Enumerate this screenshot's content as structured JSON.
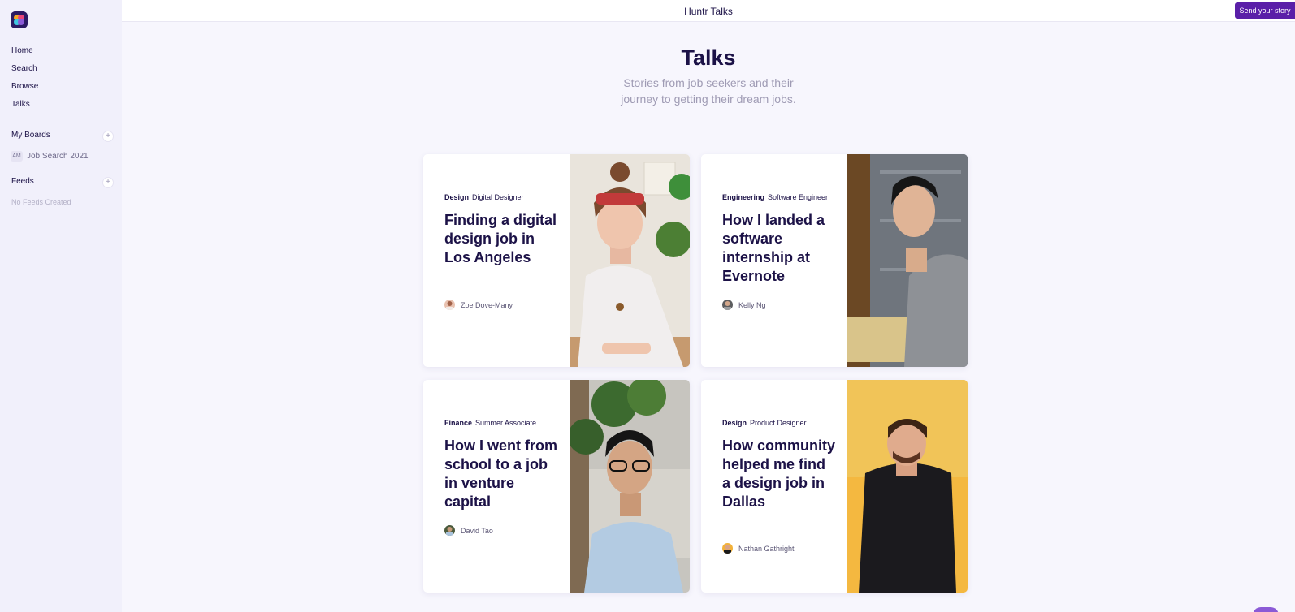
{
  "app": {
    "title": "Huntr Talks",
    "send_button": "Send your story"
  },
  "sidebar": {
    "nav": [
      "Home",
      "Search",
      "Browse",
      "Talks"
    ],
    "boards_heading": "My Boards",
    "boards": [
      {
        "initials": "AM",
        "name": "Job Search 2021"
      }
    ],
    "feeds_heading": "Feeds",
    "feeds_empty": "No Feeds Created",
    "add_symbol": "+"
  },
  "hero": {
    "title": "Talks",
    "subtitle_line1": "Stories from job seekers and their",
    "subtitle_line2": "journey to getting their dream jobs."
  },
  "cards": [
    {
      "category": "Design",
      "role": "Digital Designer",
      "title": "Finding a digital design job in Los Angeles",
      "author": "Zoe Dove-Many"
    },
    {
      "category": "Engineering",
      "role": "Software Engineer",
      "title": "How I landed a software internship at Evernote",
      "author": "Kelly Ng"
    },
    {
      "category": "Finance",
      "role": "Summer Associate",
      "title": "How I went from school to a job in venture capital",
      "author": "David Tao"
    },
    {
      "category": "Design",
      "role": "Product Designer",
      "title": "How community helped me find a design job in Dallas",
      "author": "Nathan Gathright"
    }
  ],
  "colors": {
    "accent": "#5a1fa8",
    "text": "#1c1247",
    "background": "#f7f6fd",
    "sidebar": "#f1f0fb"
  }
}
